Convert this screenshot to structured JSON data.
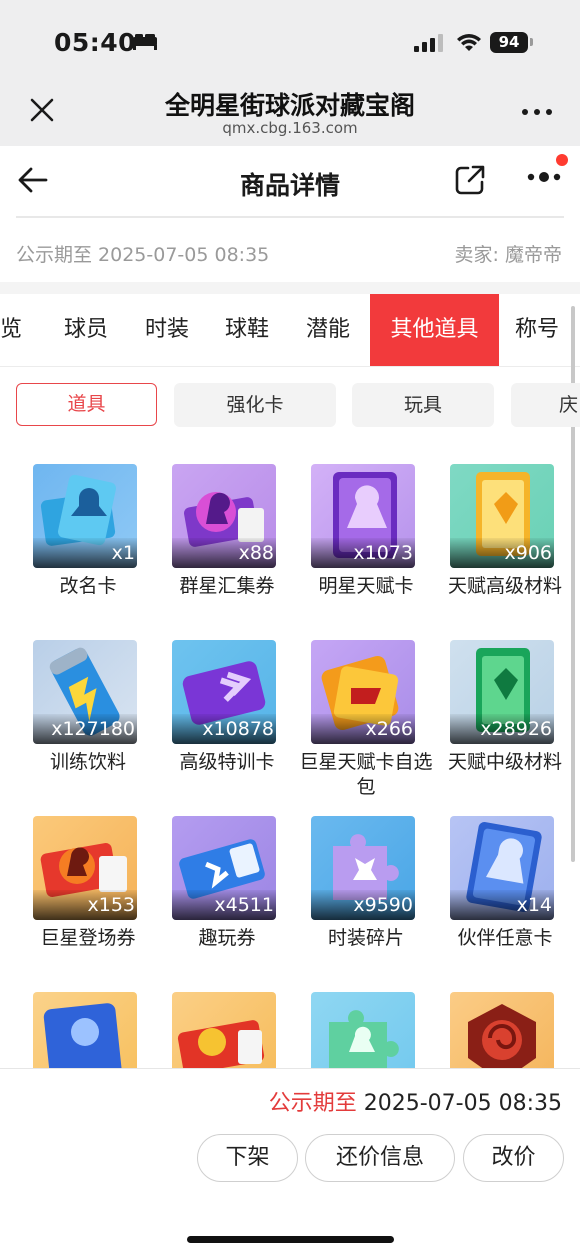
{
  "status_bar": {
    "time": "05:40",
    "battery": "94"
  },
  "browser": {
    "title": "全明星街球派对藏宝阁",
    "url": "qmx.cbg.163.com"
  },
  "nav": {
    "title": "商品详情"
  },
  "info": {
    "public_period": "公示期至 2025-07-05 08:35",
    "seller": "卖家: 魔帝帝"
  },
  "categories": [
    "总览",
    "球员",
    "时装",
    "球鞋",
    "潜能",
    "其他道具",
    "称号"
  ],
  "active_category": "其他道具",
  "subtabs": [
    "道具",
    "强化卡",
    "玩具",
    "庆"
  ],
  "active_subtab": "道具",
  "items": [
    {
      "name": "改名卡",
      "count": "x1"
    },
    {
      "name": "群星汇集券",
      "count": "x88"
    },
    {
      "name": "明星天赋卡",
      "count": "x1073"
    },
    {
      "name": "天赋高级材料",
      "count": "x906"
    },
    {
      "name": "训练饮料",
      "count": "x127180"
    },
    {
      "name": "高级特训卡",
      "count": "x10878"
    },
    {
      "name": "巨星天赋卡自选包",
      "count": "x266"
    },
    {
      "name": "天赋中级材料",
      "count": "x28926"
    },
    {
      "name": "巨星登场券",
      "count": "x153"
    },
    {
      "name": "趣玩券",
      "count": "x4511"
    },
    {
      "name": "时装碎片",
      "count": "x9590"
    },
    {
      "name": "伙伴任意卡",
      "count": "x14"
    },
    {
      "name": "",
      "count": ""
    },
    {
      "name": "",
      "count": ""
    },
    {
      "name": "",
      "count": ""
    },
    {
      "name": "",
      "count": ""
    }
  ],
  "bottom": {
    "public_label": "公示期至",
    "public_value": "2025-07-05 08:35",
    "buttons": [
      "下架",
      "还价信息",
      "改价"
    ]
  },
  "colors": {
    "accent": "#f23a3c",
    "bg_gray": "#eeeeef"
  },
  "icons": [
    "bed-icon",
    "signal-icon",
    "wifi-icon",
    "battery-icon",
    "close-icon",
    "more-icon",
    "back-arrow-icon",
    "share-icon"
  ]
}
